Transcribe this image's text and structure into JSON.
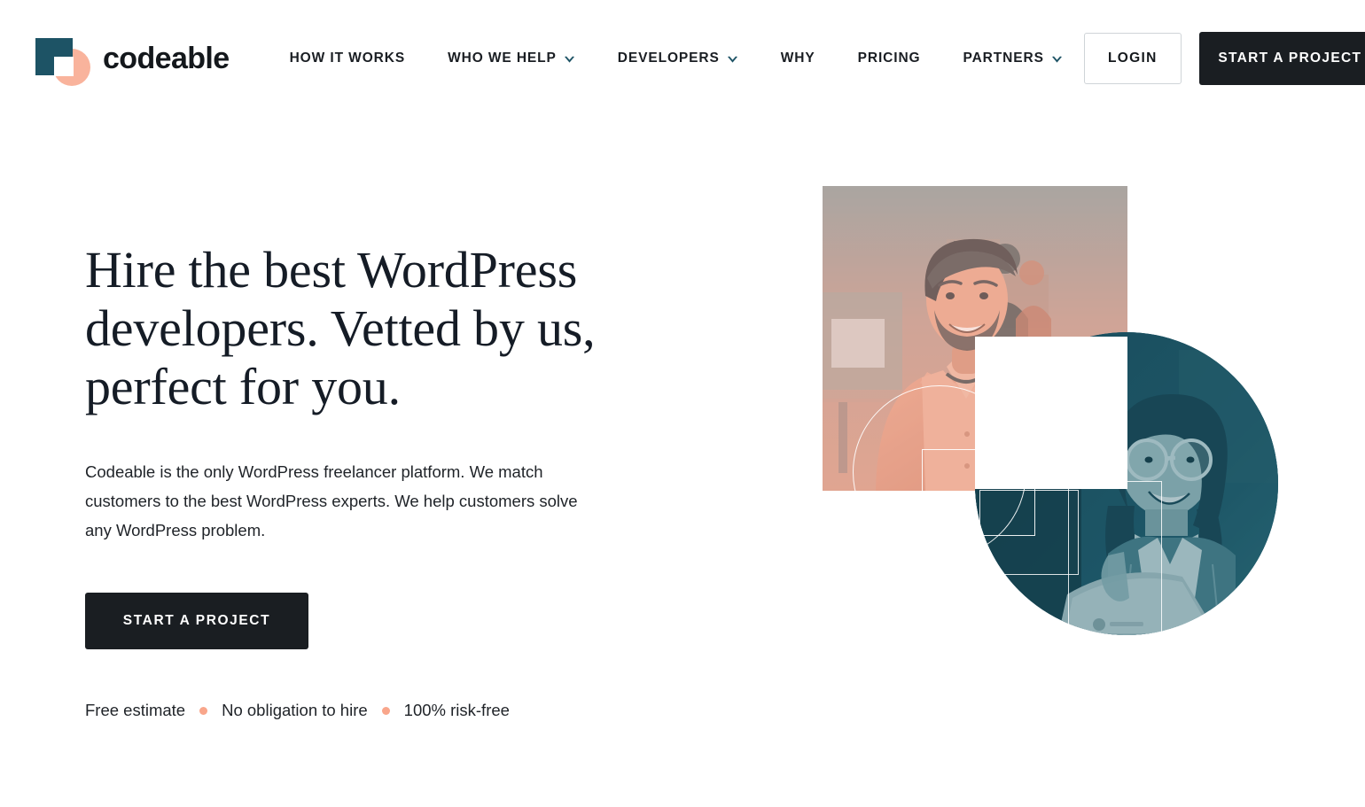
{
  "brand": {
    "name": "codeable",
    "logo_square_color": "#1d5365",
    "logo_circle_color": "#f9b39c"
  },
  "header": {
    "nav": [
      {
        "label": "HOW IT WORKS",
        "has_dropdown": false
      },
      {
        "label": "WHO WE HELP",
        "has_dropdown": true
      },
      {
        "label": "DEVELOPERS",
        "has_dropdown": true
      },
      {
        "label": "WHY",
        "has_dropdown": false
      },
      {
        "label": "PRICING",
        "has_dropdown": false
      },
      {
        "label": "PARTNERS",
        "has_dropdown": true
      }
    ],
    "login_label": "LOGIN",
    "cta_label": "START A PROJECT",
    "caret_color": "#1d5365",
    "cta_bg": "#1a1e22"
  },
  "hero": {
    "headline": "Hire the best WordPress developers. Vetted by us, perfect for you.",
    "subcopy": "Codeable is the only WordPress freelancer platform. We match customers to the best WordPress experts. We help customers solve any WordPress problem.",
    "cta_label": "START A PROJECT",
    "assurances": [
      "Free estimate",
      "No obligation to hire",
      "100% risk-free"
    ],
    "assurance_dot_color": "#f9a68b"
  },
  "hero_art": {
    "square_photo_alt": "Smiling man in an office, salmon duotone",
    "circle_photo_alt": "Smiling woman with glasses at a laptop, teal duotone",
    "salmon_tint": "#e8a493",
    "teal_tint": "#1d5365",
    "white_square_color": "#ffffff"
  }
}
